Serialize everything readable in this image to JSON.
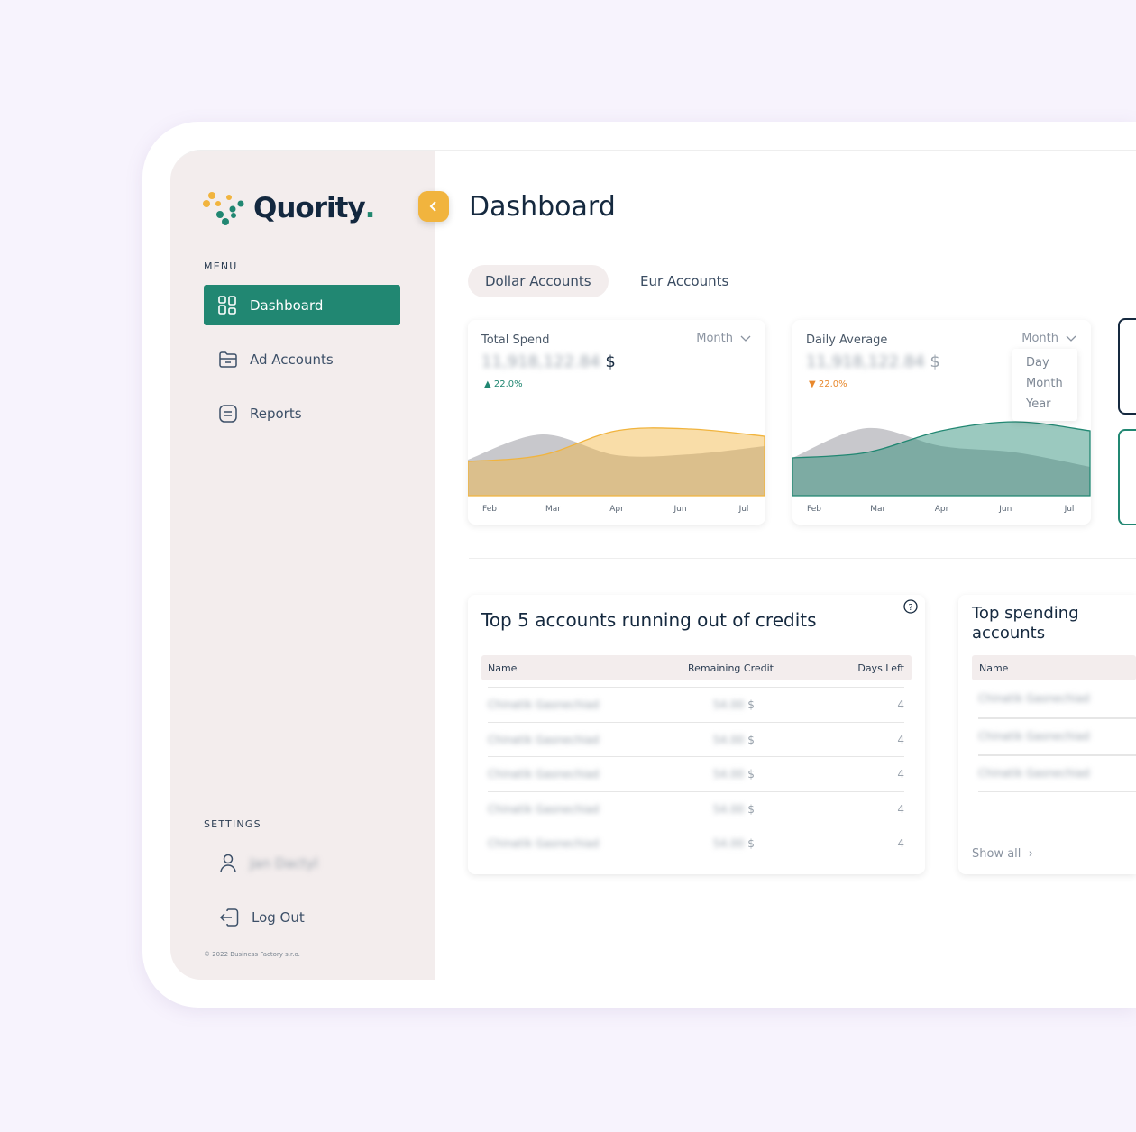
{
  "brand": {
    "name": "Quority",
    "dot": ".",
    "colors": {
      "green": "#218772",
      "yellow": "#f1b43e",
      "navy": "#15293f"
    }
  },
  "sidebar": {
    "menu_label": "MENU",
    "items": [
      {
        "label": "Dashboard",
        "icon": "grid-icon",
        "active": true
      },
      {
        "label": "Ad Accounts",
        "icon": "folder-icon"
      },
      {
        "label": "Reports",
        "icon": "document-icon"
      }
    ],
    "settings_label": "SETTINGS",
    "user_name": "Jan Dactyl",
    "logout_label": "Log Out",
    "copyright": "© 2022 Business Factory s.r.o."
  },
  "header": {
    "title": "Dashboard"
  },
  "tabs": [
    {
      "label": "Dollar Accounts",
      "active": true
    },
    {
      "label": "Eur Accounts"
    }
  ],
  "cards": [
    {
      "title": "Total Spend",
      "period": "Month",
      "value": "11,918,122.84",
      "currency": "$",
      "change": "22.0%",
      "direction": "up"
    },
    {
      "title": "Daily Average",
      "period": "Month",
      "value": "11,918,122.84",
      "currency": "$",
      "change": "22.0%",
      "direction": "down"
    }
  ],
  "period_options": [
    "Day",
    "Month",
    "Year"
  ],
  "chart_data": [
    {
      "type": "area",
      "x": [
        "Feb",
        "Mar",
        "Apr",
        "Jun",
        "Jul"
      ],
      "series": [
        {
          "values": [
            40,
            68,
            45,
            46,
            55
          ],
          "color": "#c5c5c9"
        },
        {
          "values": [
            38,
            45,
            72,
            74,
            66
          ],
          "color": "#f1b43e"
        }
      ]
    },
    {
      "type": "area",
      "x": [
        "Feb",
        "Mar",
        "Apr",
        "Jun",
        "Jul"
      ],
      "series": [
        {
          "values": [
            42,
            75,
            55,
            48,
            32
          ],
          "color": "#c5c5c9"
        },
        {
          "values": [
            42,
            48,
            72,
            82,
            72
          ],
          "color": "#218772"
        }
      ]
    }
  ],
  "credits_table": {
    "title": "Top 5 accounts running out of credits",
    "columns": [
      "Name",
      "Remaining Credit",
      "Days Left"
    ],
    "rows": [
      {
        "name": "Chinatik Gasnechiad",
        "credit": "54.00",
        "currency": "$",
        "days": "4"
      },
      {
        "name": "Chinatik Gasnechiad",
        "credit": "54.00",
        "currency": "$",
        "days": "4"
      },
      {
        "name": "Chinatik Gasnechiad",
        "credit": "54.00",
        "currency": "$",
        "days": "4"
      },
      {
        "name": "Chinatik Gasnechiad",
        "credit": "54.00",
        "currency": "$",
        "days": "4"
      },
      {
        "name": "Chinatik Gasnechiad",
        "credit": "54.00",
        "currency": "$",
        "days": "4"
      }
    ]
  },
  "spending_table": {
    "title": "Top spending accounts",
    "columns": [
      "Name"
    ],
    "rows": [
      {
        "name": "Chinatik Gasnechiad"
      },
      {
        "name": "Chinatik Gasnechiad"
      },
      {
        "name": "Chinatik Gasnechiad"
      }
    ],
    "show_all": "Show all"
  }
}
